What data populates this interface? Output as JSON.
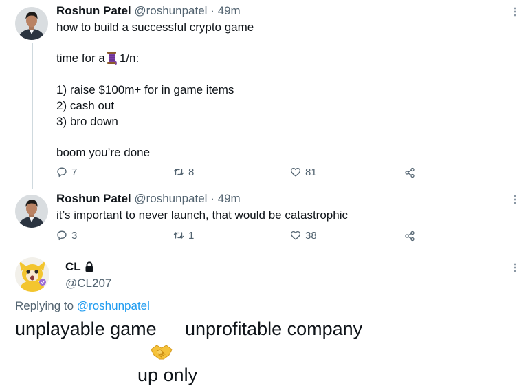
{
  "tweet1": {
    "name": "Roshun Patel",
    "handle": "@roshunpatel",
    "dot": "·",
    "time": "49m",
    "lines": [
      "how to build a successful crypto game",
      "time for a",
      "1/n:",
      "1) raise $100m+ for in game items",
      "2) cash out",
      "3) bro down",
      "boom you’re done"
    ],
    "replies": "7",
    "retweets": "8",
    "likes": "81"
  },
  "tweet2": {
    "name": "Roshun Patel",
    "handle": "@roshunpatel",
    "dot": "·",
    "time": "49m",
    "text": "it’s important to never launch, that would be catastrophic",
    "replies": "3",
    "retweets": "1",
    "likes": "38"
  },
  "reply": {
    "name": "CL",
    "handle": "@CL207",
    "replying_label": "Replying to",
    "replying_handle": "@roshunpatel",
    "left_text": "unplayable game",
    "right_text": "unprofitable company",
    "bottom_text": "up only"
  },
  "colors": {
    "text": "#0f1419",
    "secondary": "#536471",
    "link": "#1d9bf0",
    "thread_line": "#cfd9de"
  },
  "icons": [
    "reply-icon",
    "retweet-icon",
    "like-icon",
    "share-icon",
    "more-icon",
    "lock-icon",
    "spool-of-thread-icon",
    "handshake-icon"
  ]
}
